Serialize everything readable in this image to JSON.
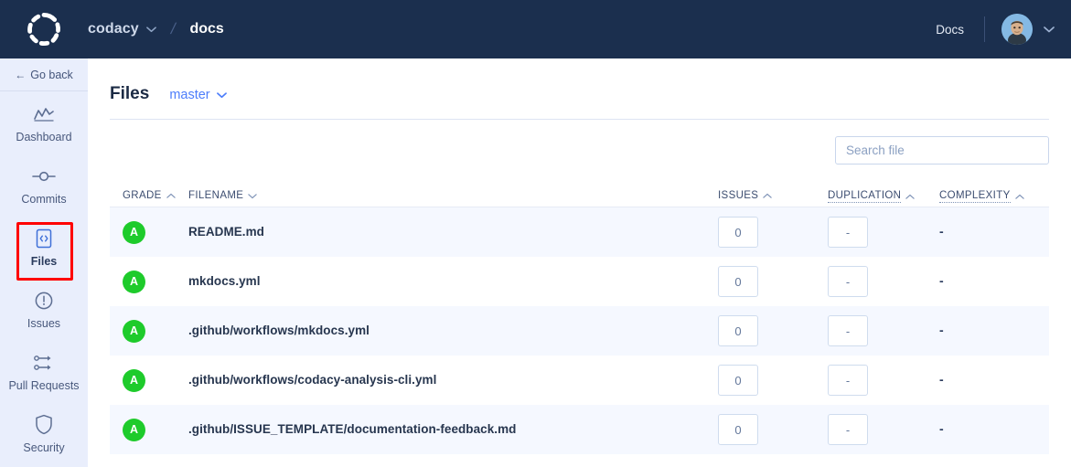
{
  "topbar": {
    "logo_icon": "codacy-logo-icon",
    "org": "codacy",
    "org_chevron_icon": "chevron-down-icon",
    "separator": "/",
    "repo": "docs",
    "docs_label": "Docs",
    "avatar_icon": "user-avatar",
    "avatar_chevron_icon": "chevron-down-icon",
    "bg_color": "#1b2f4e"
  },
  "sidebar": {
    "go_back": "Go back",
    "go_back_arrow": "←",
    "bg_color": "#e9eefc",
    "items": [
      {
        "label": "Dashboard",
        "icon": "chart-line-icon",
        "active": false
      },
      {
        "label": "Commits",
        "icon": "commit-node-icon",
        "active": false
      },
      {
        "label": "Files",
        "icon": "code-file-icon",
        "active": true
      },
      {
        "label": "Issues",
        "icon": "alert-circle-icon",
        "active": false
      },
      {
        "label": "Pull Requests",
        "icon": "pull-request-icon",
        "active": false
      },
      {
        "label": "Security",
        "icon": "shield-icon",
        "active": false
      }
    ],
    "annotation_color": "#ff0000"
  },
  "main": {
    "page_title": "Files",
    "branch": "master",
    "branch_chevron_icon": "chevron-down-icon",
    "search": {
      "placeholder": "Search file",
      "value": ""
    },
    "table": {
      "columns": [
        {
          "label": "GRADE",
          "sort_icon": "chevron-up-icon",
          "dotted": false
        },
        {
          "label": "FILENAME",
          "sort_icon": "chevron-down-icon",
          "dotted": false
        },
        {
          "label": "ISSUES",
          "sort_icon": "chevron-up-icon",
          "dotted": false
        },
        {
          "label": "DUPLICATION",
          "sort_icon": "chevron-up-icon",
          "dotted": true
        },
        {
          "label": "COMPLEXITY",
          "sort_icon": "chevron-up-icon",
          "dotted": true
        }
      ],
      "grade_color": "#1ecb2b",
      "rows": [
        {
          "grade": "A",
          "filename": "README.md",
          "issues": "0",
          "duplication": "-",
          "complexity": "-"
        },
        {
          "grade": "A",
          "filename": "mkdocs.yml",
          "issues": "0",
          "duplication": "-",
          "complexity": "-"
        },
        {
          "grade": "A",
          "filename": ".github/workflows/mkdocs.yml",
          "issues": "0",
          "duplication": "-",
          "complexity": "-"
        },
        {
          "grade": "A",
          "filename": ".github/workflows/codacy-analysis-cli.yml",
          "issues": "0",
          "duplication": "-",
          "complexity": "-"
        },
        {
          "grade": "A",
          "filename": ".github/ISSUE_TEMPLATE/documentation-feedback.md",
          "issues": "0",
          "duplication": "-",
          "complexity": "-"
        }
      ]
    }
  }
}
